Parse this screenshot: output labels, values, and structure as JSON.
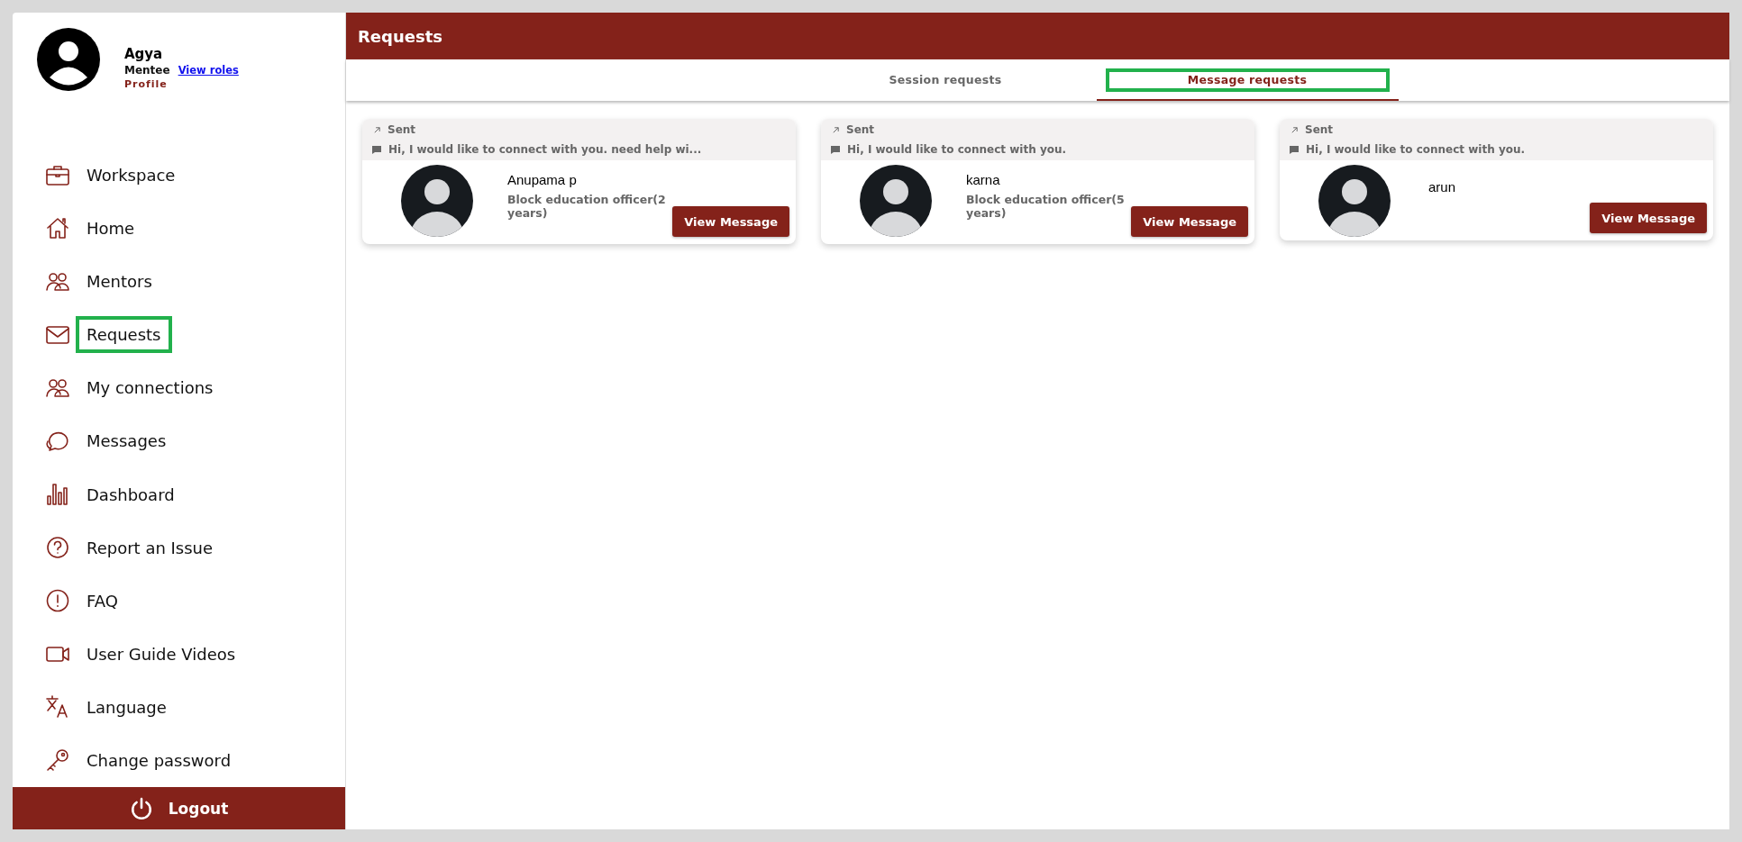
{
  "profile": {
    "name": "Agya",
    "role": "Mentee",
    "roles_link": "View roles",
    "profile_link": "Profile"
  },
  "sidebar": {
    "items": [
      {
        "label": "Workspace",
        "selected": false
      },
      {
        "label": "Home",
        "selected": false
      },
      {
        "label": "Mentors",
        "selected": false
      },
      {
        "label": "Requests",
        "selected": true
      },
      {
        "label": "My connections",
        "selected": false
      },
      {
        "label": "Messages",
        "selected": false
      },
      {
        "label": "Dashboard",
        "selected": false
      },
      {
        "label": "Report an Issue",
        "selected": false
      },
      {
        "label": "FAQ",
        "selected": false
      },
      {
        "label": "User Guide Videos",
        "selected": false
      },
      {
        "label": "Language",
        "selected": false
      },
      {
        "label": "Change password",
        "selected": false
      }
    ],
    "logout": "Logout"
  },
  "header": {
    "title": "Requests"
  },
  "tabs": [
    {
      "label": "Session requests",
      "selected": false
    },
    {
      "label": "Message requests",
      "selected": true
    }
  ],
  "cards": [
    {
      "status": "Sent",
      "message": "Hi, I would like to connect with you. need help wi...",
      "name": "Anupama p",
      "designation": "Block education officer(2 years)",
      "button": "View Message"
    },
    {
      "status": "Sent",
      "message": "Hi, I would like to connect with you.",
      "name": "karna",
      "designation": "Block education officer(5 years)",
      "button": "View Message"
    },
    {
      "status": "Sent",
      "message": "Hi, I would like to connect with you.",
      "name": "arun",
      "button": "View Message"
    }
  ]
}
